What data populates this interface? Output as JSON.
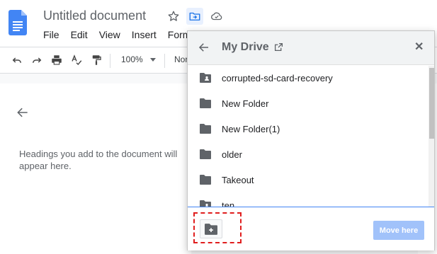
{
  "header": {
    "doc_title": "Untitled document",
    "icons": [
      "star-icon",
      "move-to-folder-icon",
      "cloud-status-icon"
    ],
    "menu": [
      "File",
      "Edit",
      "View",
      "Insert",
      "Form"
    ]
  },
  "toolbar": {
    "zoom": "100%",
    "style": "Nor"
  },
  "outline": {
    "hint": "Headings you add to the document will appear here."
  },
  "dialog": {
    "title": "My Drive",
    "folders": [
      {
        "name": "corrupted-sd-card-recovery",
        "icon": "shared-folder-icon"
      },
      {
        "name": "New Folder",
        "icon": "folder-icon"
      },
      {
        "name": "New Folder(1)",
        "icon": "folder-icon"
      },
      {
        "name": "older",
        "icon": "folder-icon"
      },
      {
        "name": "Takeout",
        "icon": "folder-icon"
      },
      {
        "name": "ten",
        "icon": "shared-folder-icon"
      }
    ],
    "move_here_label": "Move here"
  },
  "colors": {
    "accent": "#4285f4",
    "highlight": "#e01e1e",
    "move_here_bg": "#a1c2fa"
  }
}
